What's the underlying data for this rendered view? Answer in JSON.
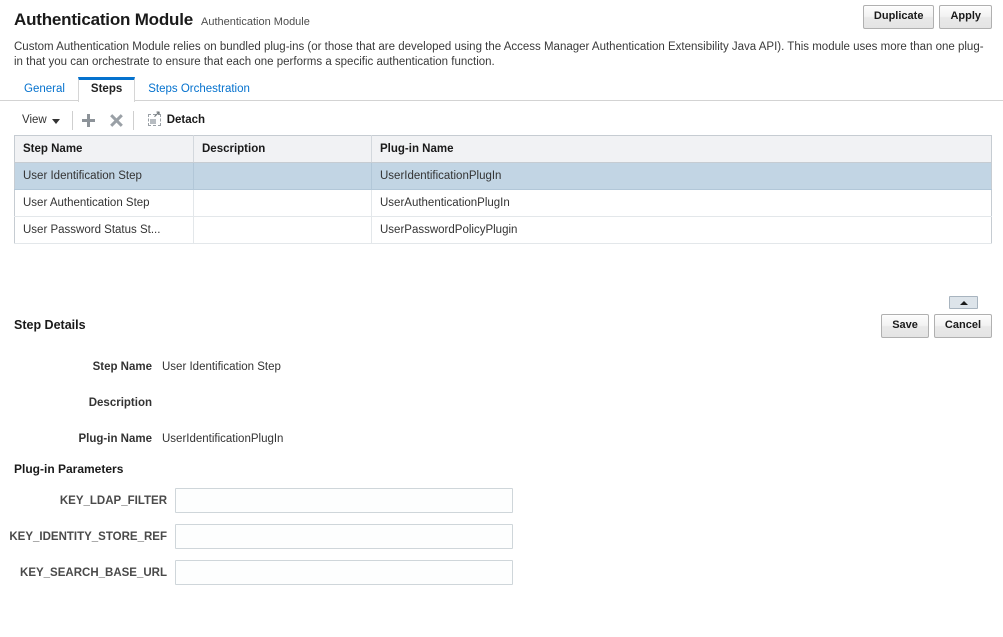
{
  "header": {
    "title": "Authentication Module",
    "subtitle": "Authentication Module",
    "duplicate_label": "Duplicate",
    "apply_label": "Apply"
  },
  "description": "Custom Authentication Module relies on bundled plug-ins (or those that are developed using the Access Manager Authentication Extensibility Java API). This module uses more than one plug-in that you can orchestrate to ensure that each one performs a specific authentication function.",
  "tabs": [
    {
      "label": "General",
      "active": false
    },
    {
      "label": "Steps",
      "active": true
    },
    {
      "label": "Steps Orchestration",
      "active": false
    }
  ],
  "toolbar": {
    "view_label": "View",
    "add_icon": "plus-icon",
    "delete_icon": "x-icon",
    "detach_icon": "detach-icon",
    "detach_label": "Detach"
  },
  "table": {
    "columns": [
      "Step Name",
      "Description",
      "Plug-in Name"
    ],
    "rows": [
      {
        "step_name": "User Identification Step",
        "description": "",
        "plugin_name": "UserIdentificationPlugIn",
        "selected": true
      },
      {
        "step_name": "User Authentication Step",
        "description": "",
        "plugin_name": "UserAuthenticationPlugIn",
        "selected": false
      },
      {
        "step_name": "User Password Status St...",
        "description": "",
        "plugin_name": "UserPasswordPolicyPlugin",
        "selected": false
      }
    ]
  },
  "splitter": {
    "collapse_icon": "caret-up-icon"
  },
  "details": {
    "title": "Step Details",
    "save_label": "Save",
    "cancel_label": "Cancel",
    "fields": [
      {
        "label": "Step Name",
        "value": "User Identification Step"
      },
      {
        "label": "Description",
        "value": ""
      },
      {
        "label": "Plug-in Name",
        "value": "UserIdentificationPlugIn"
      }
    ]
  },
  "parameters": {
    "title": "Plug-in Parameters",
    "items": [
      {
        "label": "KEY_LDAP_FILTER",
        "value": ""
      },
      {
        "label": "KEY_IDENTITY_STORE_REF",
        "value": ""
      },
      {
        "label": "KEY_SEARCH_BASE_URL",
        "value": ""
      }
    ]
  },
  "colors": {
    "accent": "#0572ce",
    "selected_row": "#c2d5e4",
    "header_bg": "#f1f2f4"
  }
}
